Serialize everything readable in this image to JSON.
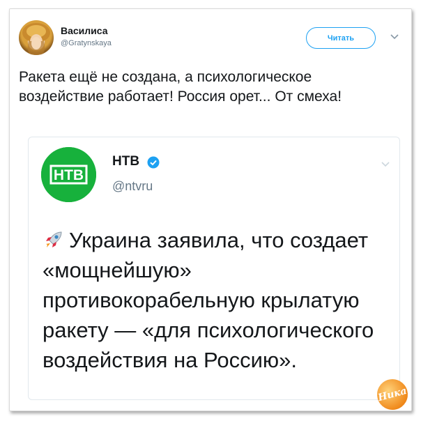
{
  "tweet": {
    "author_name": "Василиса",
    "author_handle": "@Gratynskaya",
    "follow_label": "Читать",
    "text": "Ракета ещё не создана, а психологическое воздействие работает! Россия орет... От смеха!"
  },
  "quoted_tweet": {
    "author_name": "НТВ",
    "author_handle": "@ntvru",
    "logo_text": "НТВ",
    "text": "Украина заявила, что создает «мощнейшую» противокорабельную крылатую ракету — «для психологического воздействия на Россию»."
  },
  "watermark": {
    "text": "Ника"
  },
  "colors": {
    "accent": "#1da1f2",
    "ntv_green": "#17b13c",
    "muted": "#657786"
  }
}
